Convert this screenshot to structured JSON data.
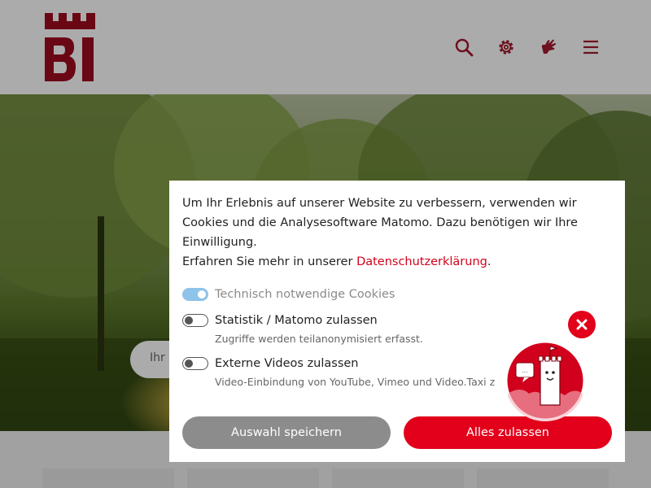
{
  "header": {
    "logo_text": "BI",
    "icons": [
      "search-icon",
      "gear-icon",
      "sign-language-icon",
      "menu-icon"
    ]
  },
  "hero": {
    "search_placeholder": "Ihr"
  },
  "cookie_dialog": {
    "intro_text": "Um Ihr Erlebnis auf unserer Website zu verbessern, verwenden wir Cookies und die Analysesoftware Matomo. Dazu benötigen wir Ihre Einwilligung.",
    "privacy_prefix": "Erfahren Sie mehr in unserer ",
    "privacy_link": "Datenschutzerklärung",
    "privacy_suffix": ".",
    "options": [
      {
        "label": "Technisch notwendige Cookies",
        "enabled": true,
        "disabled": true
      },
      {
        "label": "Statistik / Matomo zulassen",
        "description": "Zugriffe werden teilanonymisiert erfasst.",
        "enabled": false
      },
      {
        "label": "Externe Videos zulassen",
        "description": "Video-Einbindung von YouTube, Vimeo und Video.Taxi z",
        "enabled": false
      }
    ],
    "save_button": "Auswahl speichern",
    "accept_all_button": "Alles zulassen"
  },
  "mascot": {
    "close_icon": "close-icon",
    "speech_text": "..."
  },
  "colors": {
    "brand_red": "#e2001a",
    "logo_red": "#9e0b1f",
    "toggle_on": "#8ec3ea",
    "button_grey": "#8c8c8c"
  }
}
